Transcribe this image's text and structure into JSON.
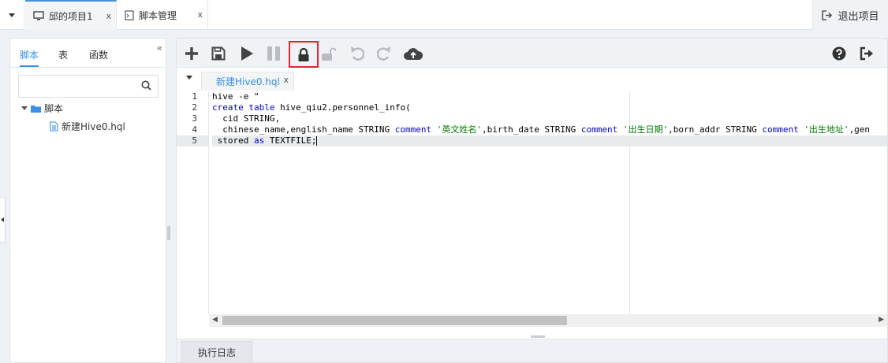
{
  "topbar": {
    "tabs": [
      {
        "label": "邱的项目1",
        "close": "x"
      },
      {
        "label": "脚本管理",
        "close": "x"
      }
    ],
    "exit_label": "退出项目"
  },
  "left_panel": {
    "tabs": [
      "脚本",
      "表",
      "函数"
    ],
    "active_tab": "脚本",
    "collapse_glyph": "«",
    "search": {
      "placeholder": "",
      "value": ""
    },
    "tree": {
      "root_label": "脚本",
      "children": [
        "新建Hive0.hql"
      ]
    }
  },
  "toolbar": {
    "icons": [
      "plus-icon",
      "save-icon",
      "play-icon",
      "pause-icon",
      "lock-icon",
      "unlock-icon",
      "undo-icon",
      "redo-icon",
      "upload-cloud-icon",
      "help-icon",
      "exit-icon"
    ],
    "highlighted": "lock-icon"
  },
  "editor": {
    "tab_label": "新建Hive0.hql",
    "tab_close": "x",
    "current_line": 5,
    "lines": [
      {
        "n": "1",
        "text": "hive -e \""
      },
      {
        "n": "2",
        "text": "create table hive_qiu2.personnel_info("
      },
      {
        "n": "3",
        "text": "  cid STRING,"
      },
      {
        "n": "4",
        "text": "  chinese_name,english_name STRING comment '英文姓名',birth_date STRING comment '出生日期',born_addr STRING comment '出生地址',gen"
      },
      {
        "n": "5",
        "text": " stored as TEXTFILE;"
      }
    ]
  },
  "log": {
    "tab_label": "执行日志"
  },
  "colors": {
    "accent": "#3a8ee6",
    "highlight": "#e0262a",
    "keyword": "#0000cc",
    "string": "#007a00"
  }
}
